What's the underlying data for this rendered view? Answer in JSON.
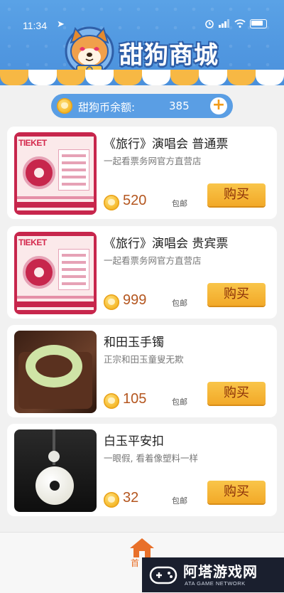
{
  "status_bar": {
    "time": "11:34",
    "location_glyph": "➤"
  },
  "header": {
    "app_title": "甜狗商城"
  },
  "balance": {
    "label": "甜狗币余额:",
    "value": "385",
    "add_glyph": "+"
  },
  "products": [
    {
      "title": "《旅行》演唱会  普通票",
      "subtitle": "一起看票务网官方直营店",
      "price": "520",
      "shipping": "包邮",
      "buy_label": "购买",
      "thumb": "concert-ticket",
      "thumb_brand": "TIEKET"
    },
    {
      "title": "《旅行》演唱会  贵宾票",
      "subtitle": "一起看票务网官方直营店",
      "price": "999",
      "shipping": "包邮",
      "buy_label": "购买",
      "thumb": "concert-ticket",
      "thumb_brand": "TIEKET"
    },
    {
      "title": "和田玉手镯",
      "subtitle": "正宗和田玉童叟无欺",
      "price": "105",
      "shipping": "包邮",
      "buy_label": "购买",
      "thumb": "jade-bangle"
    },
    {
      "title": "白玉平安扣",
      "subtitle": "一眼假, 看着像塑料一样",
      "price": "32",
      "shipping": "包邮",
      "buy_label": "购买",
      "thumb": "jade-pendant"
    }
  ],
  "bottom_nav": {
    "home_label": "首"
  },
  "watermark": {
    "title": "阿塔游戏网",
    "subtitle": "ATA GAME NETWORK"
  },
  "icons": [
    "shiba-dog-logo",
    "coin-icon",
    "add-icon",
    "home-icon",
    "gamepad-icon",
    "location-icon",
    "alarm-icon",
    "signal-icon",
    "wifi-icon",
    "battery-icon"
  ],
  "colors": {
    "header_blue": "#4a90dc",
    "awning_orange": "#f7b844",
    "buy_orange": "#f2a928",
    "price_brown": "#b4561f",
    "home_orange": "#e8702a"
  }
}
